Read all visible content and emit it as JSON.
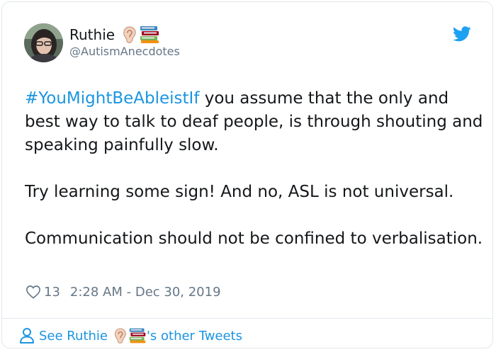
{
  "tweet": {
    "author": {
      "display_name": "Ruthie",
      "handle": "@AutismAnecdotes",
      "name_emojis": [
        "ear-emoji",
        "books-emoji"
      ]
    },
    "hashtag": "#YouMightBeAbleistIf",
    "text_line1_rest": " you assume that the only and best way to talk to deaf people, is through shouting and speaking painfully slow.",
    "paragraph2": "Try learning some sign! And no, ASL is not universal.",
    "paragraph3": "Communication should not be confined to verbalisation.",
    "likes": "13",
    "timestamp": "2:28 AM - Dec 30, 2019"
  },
  "footer": {
    "prefix": "See Ruthie",
    "suffix": "'s other Tweets"
  },
  "colors": {
    "link": "#1b95e0",
    "muted": "#657786",
    "border": "#e1e8ed"
  }
}
